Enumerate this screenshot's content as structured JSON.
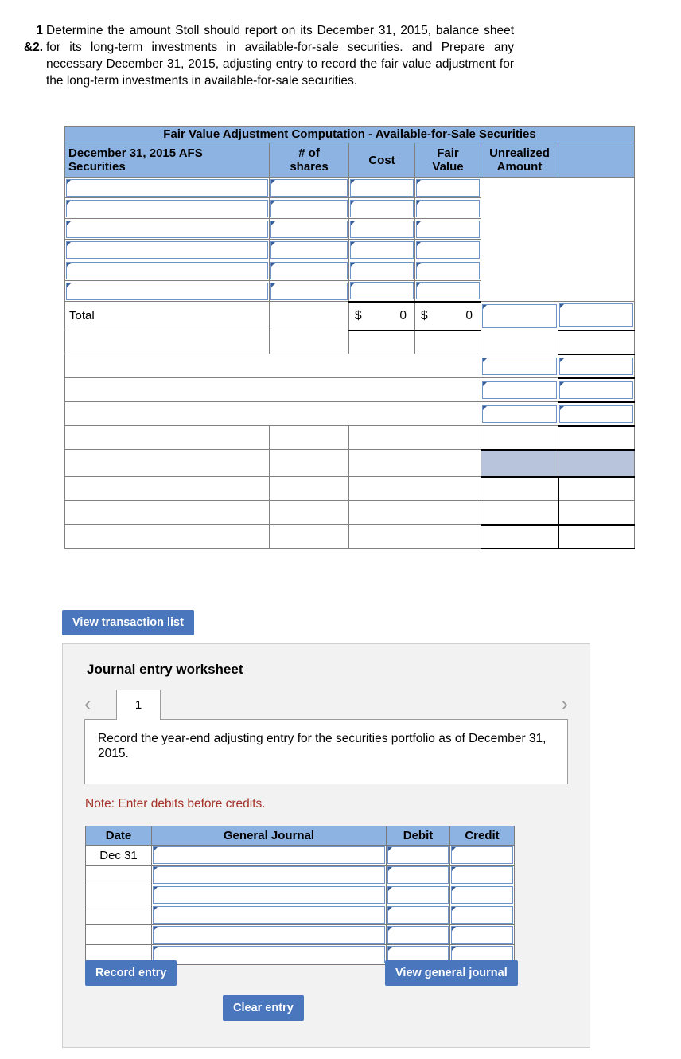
{
  "question": {
    "number": "1\n&2.",
    "text": "Determine the amount Stoll should report on its December 31, 2015, balance sheet for its long-term investments in available-for-sale securities. and Prepare any necessary December 31, 2015, adjusting entry to record the fair value adjustment for the long-term investments in available-for-sale securities."
  },
  "afs_table": {
    "title": "Fair Value Adjustment Computation - Available-for-Sale Securities",
    "columns": [
      "December 31, 2015 AFS Securities",
      "# of shares",
      "Cost",
      "Fair Value",
      "Unrealized Amount",
      ""
    ],
    "column_lines": {
      "c0_line1": "December 31, 2015 AFS",
      "c0_line2": "Securities",
      "c1_line1": "# of",
      "c1_line2": "shares",
      "c2": "Cost",
      "c3_line1": "Fair",
      "c3_line2": "Value",
      "c4_line1": "Unrealized",
      "c4_line2": "Amount"
    },
    "input_rows_count": 6,
    "total_row": {
      "label": "Total",
      "shares": "",
      "cost_sign": "$",
      "cost_value": "0",
      "fair_sign": "$",
      "fair_value": "0"
    }
  },
  "buttons": {
    "view_transaction_list": "View transaction list",
    "record_entry": "Record entry",
    "clear_entry": "Clear entry",
    "view_general_journal": "View general journal"
  },
  "journal": {
    "title": "Journal entry worksheet",
    "active_tab": "1",
    "prev_icon": "‹",
    "next_icon": "›",
    "prompt": "Record the year-end adjusting entry for the securities portfolio as of December 31, 2015.",
    "note": "Note: Enter debits before credits.",
    "columns": [
      "Date",
      "General Journal",
      "Debit",
      "Credit"
    ],
    "rows": [
      {
        "date": "Dec 31",
        "general_journal": "",
        "debit": "",
        "credit": ""
      },
      {
        "date": "",
        "general_journal": "",
        "debit": "",
        "credit": ""
      },
      {
        "date": "",
        "general_journal": "",
        "debit": "",
        "credit": ""
      },
      {
        "date": "",
        "general_journal": "",
        "debit": "",
        "credit": ""
      },
      {
        "date": "",
        "general_journal": "",
        "debit": "",
        "credit": ""
      },
      {
        "date": "",
        "general_journal": "",
        "debit": "",
        "credit": ""
      }
    ]
  },
  "colors": {
    "header_blue": "#8DB3E2",
    "button_blue": "#4A76BD",
    "highlight_cell": "#B8C4DC",
    "note_red": "#A33126",
    "panel_bg": "#F2F2F2",
    "input_border": "#6E93C8"
  }
}
